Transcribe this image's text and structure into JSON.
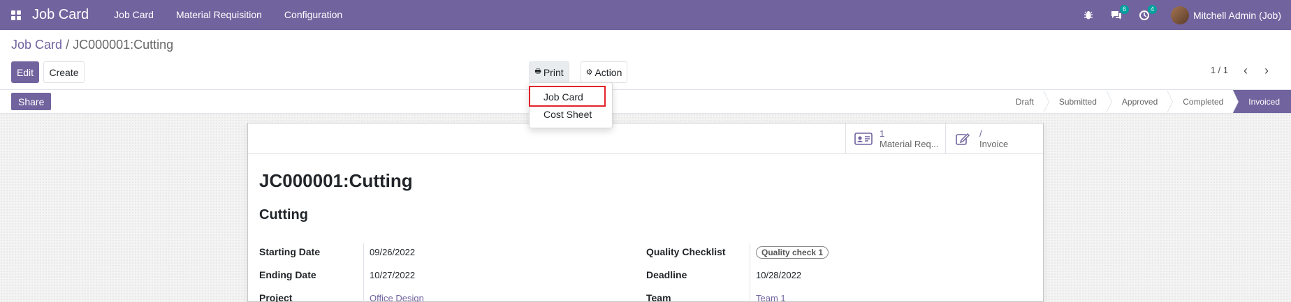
{
  "navbar": {
    "brand": "Job Card",
    "menu": [
      "Job Card",
      "Material Requisition",
      "Configuration"
    ],
    "chat_badge": "6",
    "activity_badge": "4",
    "user": "Mitchell Admin (Job)"
  },
  "breadcrumb": {
    "parent": "Job Card",
    "separator": "/",
    "current": "JC000001:Cutting"
  },
  "toolbar": {
    "edit": "Edit",
    "create": "Create",
    "print": "Print",
    "action": "Action",
    "pager": "1 / 1"
  },
  "print_menu": {
    "items": [
      "Job Card",
      "Cost Sheet"
    ]
  },
  "statusbar": {
    "share": "Share",
    "stages": [
      "Draft",
      "Submitted",
      "Approved",
      "Completed",
      "Invoiced"
    ],
    "active_stage": "Invoiced"
  },
  "smart_buttons": {
    "material": {
      "value": "1",
      "label": "Material Req..."
    },
    "invoice": {
      "value": "/",
      "label": "Invoice"
    }
  },
  "record": {
    "title": "JC000001:Cutting",
    "subtitle": "Cutting",
    "fields": {
      "starting_date": {
        "label": "Starting Date",
        "value": "09/26/2022"
      },
      "ending_date": {
        "label": "Ending Date",
        "value": "10/27/2022"
      },
      "project": {
        "label": "Project",
        "value": "Office Design"
      },
      "quality_checklist": {
        "label": "Quality Checklist",
        "value": "Quality check 1"
      },
      "deadline": {
        "label": "Deadline",
        "value": "10/28/2022"
      },
      "team": {
        "label": "Team",
        "value": "Team 1"
      }
    }
  },
  "colors": {
    "brand": "#71639e",
    "highlight": "#e2232a",
    "badge": "#00a09d"
  }
}
